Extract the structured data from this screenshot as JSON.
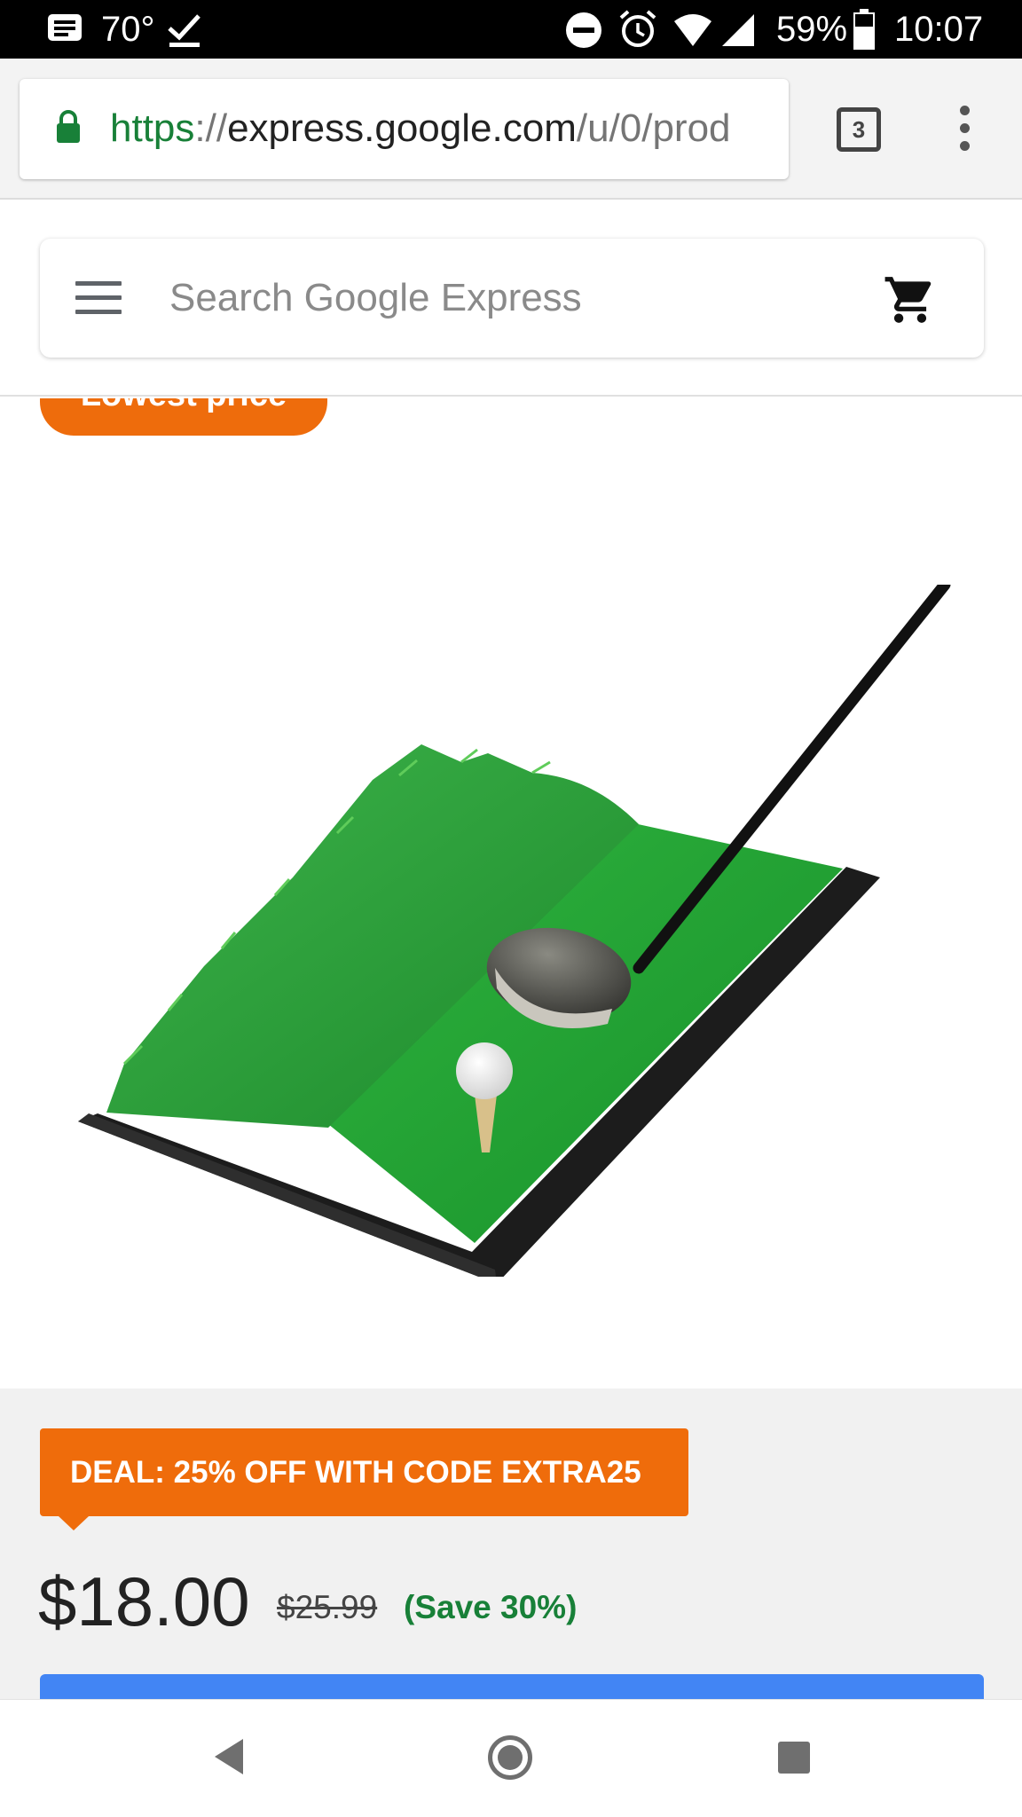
{
  "status_bar": {
    "temperature": "70°",
    "battery": "59%",
    "time": "10:07",
    "icons": [
      "notification-icon",
      "check-icon",
      "do-not-disturb-icon",
      "alarm-icon",
      "wifi-icon",
      "signal-icon",
      "battery-icon"
    ]
  },
  "browser": {
    "url_scheme": "https",
    "url_sep": "://",
    "url_host": "express.google.com",
    "url_path": "/u/0/prod",
    "tab_count": "3"
  },
  "app": {
    "search_placeholder": "Search Google Express"
  },
  "product": {
    "badge": "Lowest price",
    "image_alt": "golf-hitting-mat-with-driver-and-ball",
    "deal": "DEAL: 25% OFF WITH CODE EXTRA25",
    "price": "$18.00",
    "original_price": "$25.99",
    "savings": "(Save 30%)"
  },
  "colors": {
    "badge_orange": "#ee6c0c",
    "deal_orange": "#ef6c0b",
    "save_green": "#188038",
    "button_blue": "#4285f4",
    "lock_green": "#188038"
  }
}
